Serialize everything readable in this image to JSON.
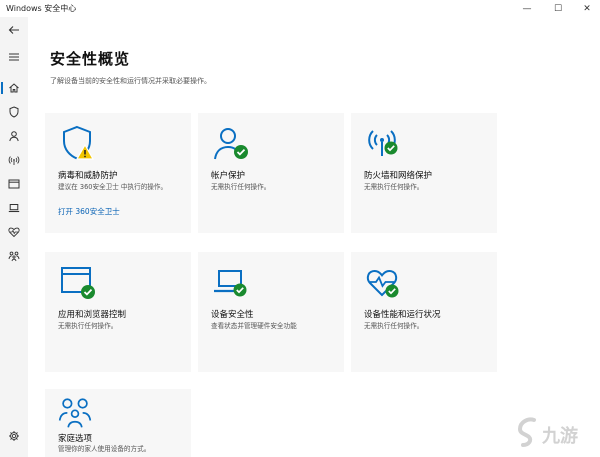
{
  "window": {
    "title": "Windows 安全中心",
    "minimize_glyph": "—",
    "maximize_glyph": "☐",
    "close_glyph": "✕"
  },
  "sidebar": {
    "items": [
      {
        "icon": "back-arrow-icon"
      },
      {
        "icon": "hamburger-menu-icon"
      },
      {
        "icon": "home-icon",
        "active": true
      },
      {
        "icon": "shield-icon"
      },
      {
        "icon": "person-icon"
      },
      {
        "icon": "wifi-signal-icon"
      },
      {
        "icon": "browser-window-icon"
      },
      {
        "icon": "laptop-icon"
      },
      {
        "icon": "heart-health-icon"
      },
      {
        "icon": "family-icon"
      },
      {
        "icon": "gear-icon"
      }
    ]
  },
  "main": {
    "title": "安全性概览",
    "description": "了解设备当前的安全性和运行情况并采取必要操作。"
  },
  "cards": [
    {
      "id": "virus",
      "title": "病毒和威胁防护",
      "desc": "建议在 360安全卫士 中执行的操作。",
      "link": "打开 360安全卫士",
      "icon": "shield-warning-icon",
      "status": "warning"
    },
    {
      "id": "account",
      "title": "帐户保护",
      "desc": "无需执行任何操作。",
      "icon": "person-check-icon",
      "status": "ok"
    },
    {
      "id": "firewall",
      "title": "防火墙和网络保护",
      "desc": "无需执行任何操作。",
      "icon": "wifi-check-icon",
      "status": "ok"
    },
    {
      "id": "app-browser",
      "title": "应用和浏览器控制",
      "desc": "无需执行任何操作。",
      "icon": "browser-check-icon",
      "status": "ok"
    },
    {
      "id": "device-security",
      "title": "设备安全性",
      "desc": "查看状态并管理硬件安全功能",
      "icon": "laptop-check-icon",
      "status": "ok"
    },
    {
      "id": "device-health",
      "title": "设备性能和运行状况",
      "desc": "无需执行任何操作。",
      "icon": "heart-health-check-icon",
      "status": "ok"
    },
    {
      "id": "family",
      "title": "家庭选项",
      "desc": "管理你的家人使用设备的方式。",
      "icon": "family-icon"
    }
  ],
  "watermark": {
    "text": "九游"
  },
  "colors": {
    "accent_blue": "#0a6fc2",
    "check_green": "#1a8a2e",
    "warning_yellow": "#f2c500",
    "card_bg": "#f7f7f7",
    "sidebar_bg": "#f4f4f4"
  }
}
